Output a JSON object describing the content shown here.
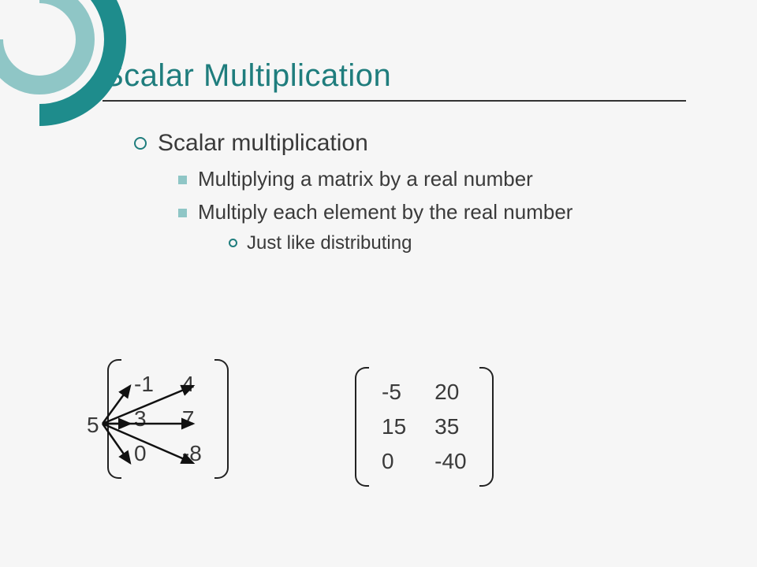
{
  "title": "Scalar Multiplication",
  "bullets": {
    "level1": "Scalar multiplication",
    "level2a": "Multiplying a matrix by a real number",
    "level2b": "Multiply each element by the real number",
    "level3": "Just like distributing"
  },
  "example": {
    "scalar": "5",
    "input_matrix": [
      [
        "-1",
        "4"
      ],
      [
        "3",
        "7"
      ],
      [
        "0",
        "-8"
      ]
    ],
    "output_matrix": [
      [
        "-5",
        "20"
      ],
      [
        "15",
        "35"
      ],
      [
        "0",
        "-40"
      ]
    ]
  }
}
